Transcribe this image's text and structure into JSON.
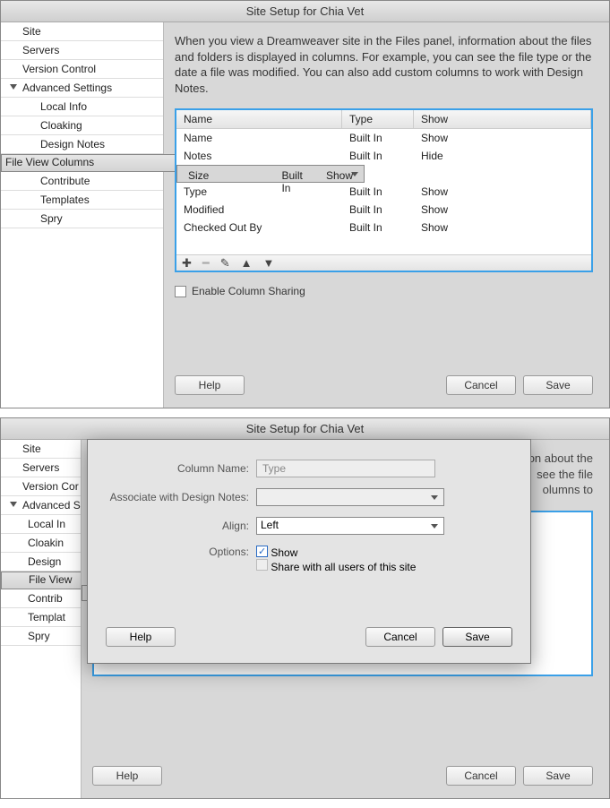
{
  "window_title": "Site Setup for Chia Vet",
  "sidebar": {
    "site": "Site",
    "servers": "Servers",
    "version_control": "Version Control",
    "advanced": "Advanced Settings",
    "local_info": "Local Info",
    "cloaking": "Cloaking",
    "design_notes": "Design Notes",
    "file_view_columns": "File View Columns",
    "contribute": "Contribute",
    "templates": "Templates",
    "spry": "Spry"
  },
  "description": "When you view a Dreamweaver site in the Files panel, information about the files and folders is displayed in columns. For example, you can see the file type or the date a file was modified. You can also add custom columns to work with Design Notes.",
  "headers": {
    "name": "Name",
    "type": "Type",
    "show": "Show"
  },
  "rows": [
    {
      "name": "Name",
      "type": "Built In",
      "show": "Show"
    },
    {
      "name": "Notes",
      "type": "Built In",
      "show": "Hide"
    },
    {
      "name": "Size",
      "type": "Built In",
      "show": "Show"
    },
    {
      "name": "Type",
      "type": "Built In",
      "show": "Show"
    },
    {
      "name": "Modified",
      "type": "Built In",
      "show": "Show"
    },
    {
      "name": "Checked Out By",
      "type": "Built In",
      "show": "Show"
    }
  ],
  "enable_sharing": "Enable Column Sharing",
  "buttons": {
    "help": "Help",
    "cancel": "Cancel",
    "save": "Save"
  },
  "dialog": {
    "column_name_label": "Column Name:",
    "column_name_value": "Type",
    "associate_label": "Associate with Design Notes:",
    "align_label": "Align:",
    "align_value": "Left",
    "options_label": "Options:",
    "show_label": "Show",
    "share_label": "Share with all users of this site"
  },
  "sidebar2": {
    "site": "Site",
    "servers": "Servers",
    "version_control": "Version Cor",
    "advanced": "Advanced S",
    "local_info": "Local In",
    "cloaking": "Cloakin",
    "design_notes": "Design",
    "file_view_columns": "File View",
    "contribute": "Contrib",
    "templates": "Templat",
    "spry": "Spry"
  }
}
